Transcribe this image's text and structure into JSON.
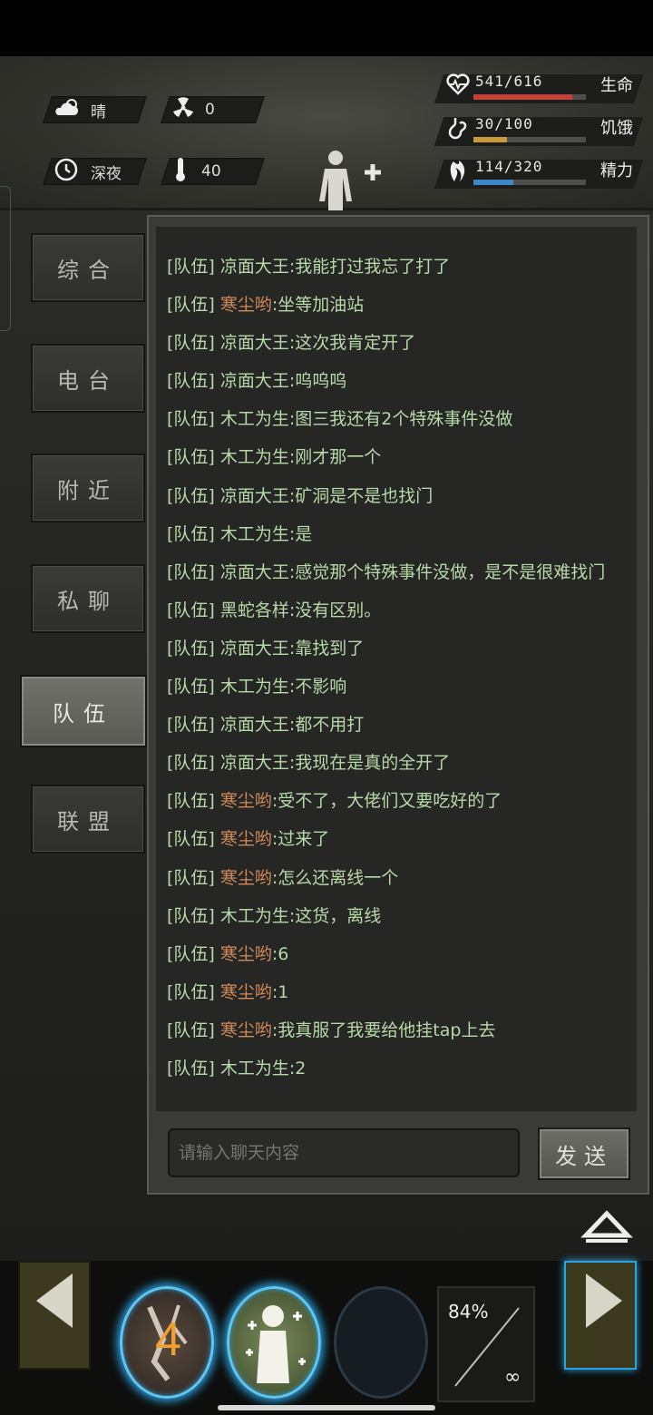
{
  "status": {
    "weather": {
      "icon": "partly-cloudy-icon",
      "label": "晴"
    },
    "radiation": {
      "icon": "radiation-icon",
      "value": "0"
    },
    "time_of_day": {
      "icon": "clock-icon",
      "label": "深夜"
    },
    "temperature": {
      "icon": "thermometer-icon",
      "value": "40"
    },
    "bars": [
      {
        "icon": "heart-rate-icon",
        "value": "541/616",
        "name": "生命",
        "fraction": 0.878,
        "color": "#c0423b"
      },
      {
        "icon": "stomach-icon",
        "value": "30/100",
        "name": "饥饿",
        "fraction": 0.3,
        "color": "#c99a3a"
      },
      {
        "icon": "energy-icon",
        "value": "114/320",
        "name": "精力",
        "fraction": 0.356,
        "color": "#3f86c4"
      }
    ]
  },
  "tabs": [
    {
      "label": "综合",
      "active": false
    },
    {
      "label": "电台",
      "active": false
    },
    {
      "label": "附近",
      "active": false
    },
    {
      "label": "私聊",
      "active": false
    },
    {
      "label": "队伍",
      "active": true
    },
    {
      "label": "联盟",
      "active": false
    }
  ],
  "chat": {
    "messages": [
      {
        "channel": "[队伍]",
        "name": "凉面大王",
        "other": false,
        "text": ":我能打过我忘了打了"
      },
      {
        "channel": "[队伍]",
        "name": "寒尘哟",
        "other": true,
        "text": ":坐等加油站"
      },
      {
        "channel": "[队伍]",
        "name": "凉面大王",
        "other": false,
        "text": ":这次我肯定开了"
      },
      {
        "channel": "[队伍]",
        "name": "凉面大王",
        "other": false,
        "text": ":呜呜呜"
      },
      {
        "channel": "[队伍]",
        "name": "木工为生",
        "other": false,
        "text": ":图三我还有2个特殊事件没做"
      },
      {
        "channel": "[队伍]",
        "name": "木工为生",
        "other": false,
        "text": ":刚才那一个"
      },
      {
        "channel": "[队伍]",
        "name": "凉面大王",
        "other": false,
        "text": ":矿洞是不是也找门"
      },
      {
        "channel": "[队伍]",
        "name": "木工为生",
        "other": false,
        "text": ":是"
      },
      {
        "channel": "[队伍]",
        "name": "凉面大王",
        "other": false,
        "text": ":感觉那个特殊事件没做，是不是很难找门"
      },
      {
        "channel": "[队伍]",
        "name": "黑蛇各样",
        "other": false,
        "text": ":没有区别。"
      },
      {
        "channel": "[队伍]",
        "name": "凉面大王",
        "other": false,
        "text": ":靠找到了"
      },
      {
        "channel": "[队伍]",
        "name": "木工为生",
        "other": false,
        "text": ":不影响"
      },
      {
        "channel": "[队伍]",
        "name": "凉面大王",
        "other": false,
        "text": ":都不用打"
      },
      {
        "channel": "[队伍]",
        "name": "凉面大王",
        "other": false,
        "text": ":我现在是真的全开了"
      },
      {
        "channel": "[队伍]",
        "name": "寒尘哟",
        "other": true,
        "text": ":受不了，大佬们又要吃好的了"
      },
      {
        "channel": "[队伍]",
        "name": "寒尘哟",
        "other": true,
        "text": ":过来了"
      },
      {
        "channel": "[队伍]",
        "name": "寒尘哟",
        "other": true,
        "text": ":怎么还离线一个"
      },
      {
        "channel": "[队伍]",
        "name": "木工为生",
        "other": false,
        "text": ":这货，离线"
      },
      {
        "channel": "[队伍]",
        "name": "寒尘哟",
        "other": true,
        "text": ":6"
      },
      {
        "channel": "[队伍]",
        "name": "寒尘哟",
        "other": true,
        "text": ":1"
      },
      {
        "channel": "[队伍]",
        "name": "寒尘哟",
        "other": true,
        "text": ":我真服了我要给他挂tap上去"
      },
      {
        "channel": "[队伍]",
        "name": "木工为生",
        "other": false,
        "text": ":2"
      }
    ],
    "input_placeholder": "请输入聊天内容",
    "send_label": "发送"
  },
  "quickbar": {
    "slot1_count": "4",
    "slot1_icon": "cracked-item-icon",
    "slot2_icon": "healing-figure-icon",
    "slot4_percent": "84%",
    "slot4_symbol": "∞"
  }
}
